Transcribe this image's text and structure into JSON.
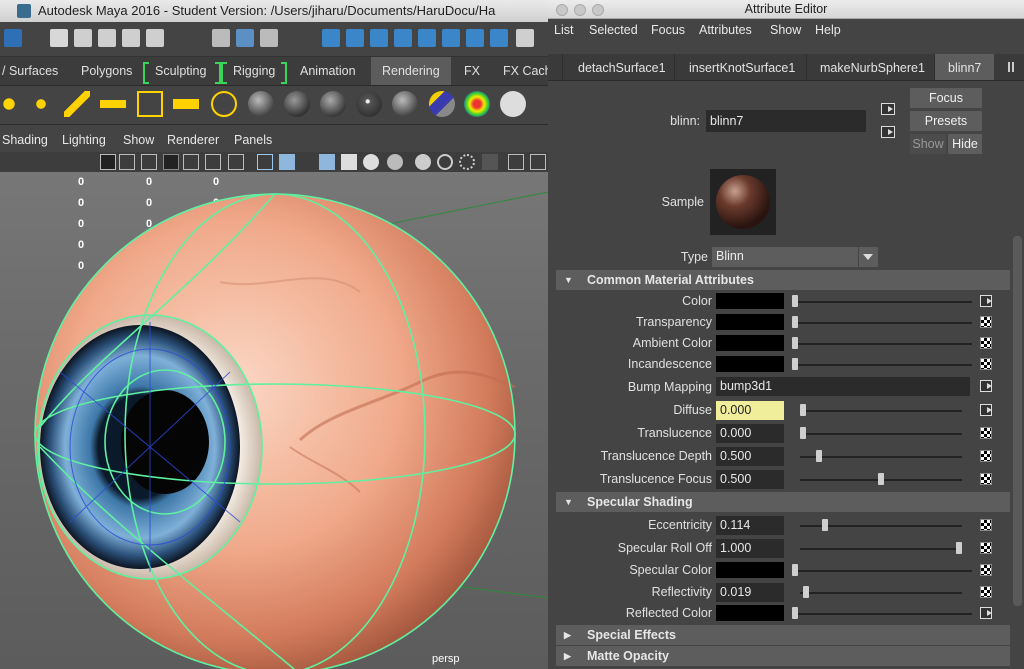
{
  "maya": {
    "title": "Autodesk Maya 2016 - Student Version: /Users/jiharu/Documents/HaruDocu/Ha",
    "shelf_tabs": [
      "/ Surfaces",
      "Polygons",
      "Sculpting",
      "Rigging",
      "Animation",
      "Rendering",
      "FX",
      "FX Cach"
    ],
    "active_shelf_tab": "Rendering",
    "panel_menu": [
      "Shading",
      "Lighting",
      "Show",
      "Renderer",
      "Panels"
    ],
    "hud_values": [
      "0",
      "0",
      "0",
      "0",
      "0",
      "0",
      "0",
      "0",
      "0",
      "0",
      "0",
      "0",
      "0",
      "0",
      "0"
    ],
    "camera_label": "persp",
    "wireframe_color": "#5ff0a0"
  },
  "attribute_editor": {
    "title": "Attribute Editor",
    "menu": [
      "List",
      "Selected",
      "Focus",
      "Attributes",
      "Show",
      "Help"
    ],
    "tabs": [
      "detachSurface1",
      "insertKnotSurface1",
      "makeNurbSphere1",
      "blinn7"
    ],
    "active_tab": "blinn7",
    "node_label": "blinn:",
    "node_name": "blinn7",
    "focus_button": "Focus",
    "presets_button": "Presets",
    "show_button": "Show",
    "hide_button": "Hide",
    "sample_label": "Sample",
    "type_label": "Type",
    "type_value": "Blinn",
    "sections": {
      "common": "Common Material Attributes",
      "specular": "Specular Shading",
      "special": "Special Effects",
      "matte": "Matte Opacity"
    },
    "common_attrs": {
      "color": {
        "label": "Color",
        "slider": 0.0
      },
      "transparency": {
        "label": "Transparency",
        "slider": 0.0
      },
      "ambient": {
        "label": "Ambient Color",
        "slider": 0.0
      },
      "incandescence": {
        "label": "Incandescence",
        "slider": 0.0
      },
      "bump": {
        "label": "Bump Mapping",
        "value": "bump3d1"
      },
      "diffuse": {
        "label": "Diffuse",
        "value": "0.000",
        "slider": 0.0
      },
      "translucence": {
        "label": "Translucence",
        "value": "0.000",
        "slider": 0.0
      },
      "translucence_depth": {
        "label": "Translucence Depth",
        "value": "0.500",
        "slider": 0.1
      },
      "translucence_focus": {
        "label": "Translucence Focus",
        "value": "0.500",
        "slider": 0.5
      }
    },
    "specular_attrs": {
      "eccentricity": {
        "label": "Eccentricity",
        "value": "0.114",
        "slider": 0.14
      },
      "rolloff": {
        "label": "Specular Roll Off",
        "value": "1.000",
        "slider": 1.0
      },
      "spec_color": {
        "label": "Specular Color",
        "slider": 0.0
      },
      "reflectivity": {
        "label": "Reflectivity",
        "value": "0.019",
        "slider": 0.02
      },
      "reflected": {
        "label": "Reflected Color",
        "slider": 0.0
      }
    }
  }
}
